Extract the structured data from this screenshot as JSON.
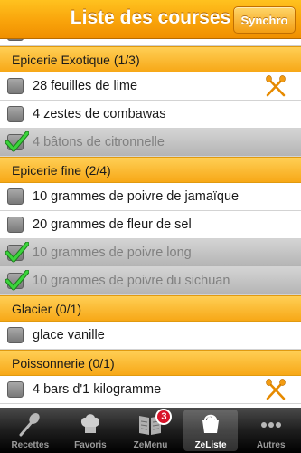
{
  "header": {
    "title": "Liste des courses",
    "sync_label": "Synchro"
  },
  "sections": [
    {
      "title": "Epicerie Exotique (1/3)",
      "items": [
        {
          "label": "28 feuilles de lime",
          "checked": false,
          "icon": "utensils"
        },
        {
          "label": "4 zestes de combawas",
          "checked": false
        },
        {
          "label": "4 bâtons de citronnelle",
          "checked": true
        }
      ]
    },
    {
      "title": "Epicerie fine (2/4)",
      "items": [
        {
          "label": "10 grammes de poivre de jamaïque",
          "checked": false
        },
        {
          "label": "20 grammes de fleur de sel",
          "checked": false
        },
        {
          "label": "10 grammes de poivre long",
          "checked": true
        },
        {
          "label": "10 grammes de poivre du sichuan",
          "checked": true
        }
      ]
    },
    {
      "title": "Glacier (0/1)",
      "items": [
        {
          "label": "glace vanille",
          "checked": false
        }
      ]
    },
    {
      "title": "Poissonnerie (0/1)",
      "items": [
        {
          "label": "4 bars d'1 kilogramme",
          "checked": false,
          "icon": "utensils"
        }
      ]
    }
  ],
  "tabs": [
    {
      "label": "Recettes",
      "icon": "spoon-icon"
    },
    {
      "label": "Favoris",
      "icon": "chef-hat-icon"
    },
    {
      "label": "ZeMenu",
      "icon": "book-icon",
      "badge": "3"
    },
    {
      "label": "ZeListe",
      "icon": "basket-icon",
      "active": true
    },
    {
      "label": "Autres",
      "icon": "more-icon"
    }
  ],
  "colors": {
    "accent": "#f9a40b",
    "check": "#2db82d",
    "tabbar": "#1e1e1e"
  }
}
